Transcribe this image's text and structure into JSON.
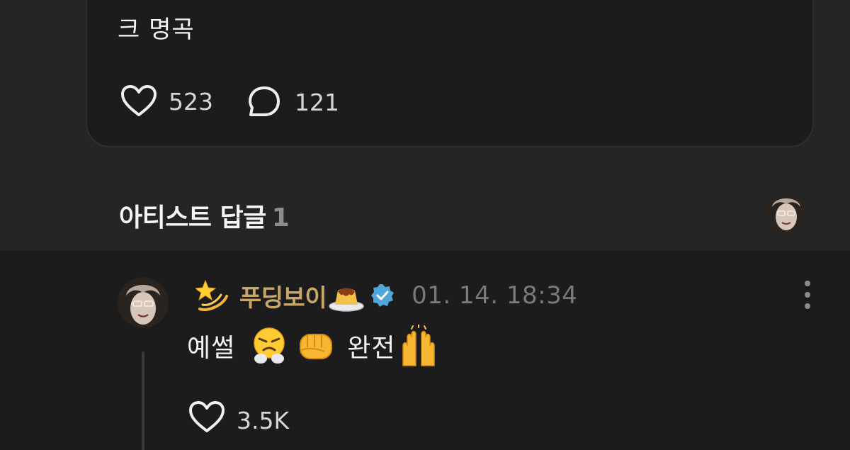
{
  "post": {
    "text": "크 명곡",
    "likes": "523",
    "comments": "121"
  },
  "replies_header": {
    "title": "아티스트 답글",
    "count": "1"
  },
  "reply": {
    "username": "푸딩보이",
    "timestamp": "01. 14. 18:34",
    "text_part1": "예썰",
    "text_part2": "완전",
    "likes": "3.5K",
    "emoji": [
      "dizzy-star-emoji",
      "pudding-emoji",
      "verified-badge",
      "steaming-face-emoji",
      "fist-emoji",
      "raising-hands-emoji"
    ]
  },
  "colors": {
    "background": "#252525",
    "card": "#1c1c1c",
    "username": "#c7a86a",
    "verified": "#4fa6d9",
    "muted": "#7a7a7a"
  }
}
